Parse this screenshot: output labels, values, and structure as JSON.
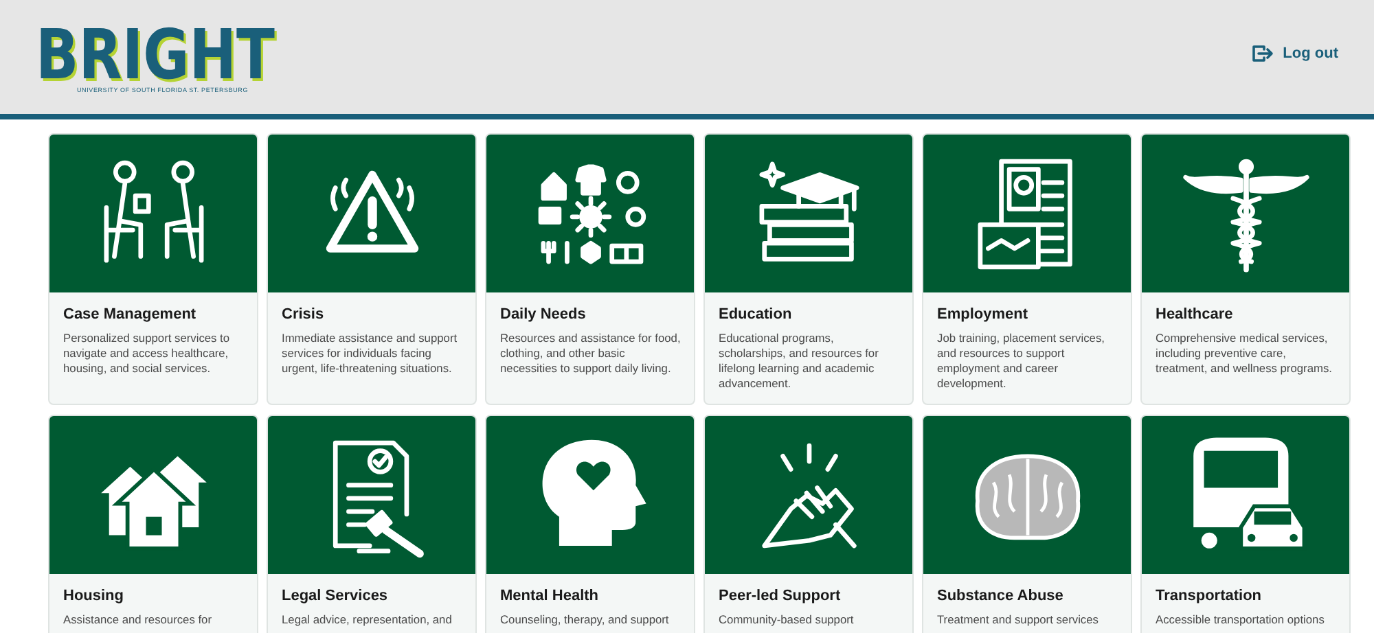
{
  "header": {
    "logo": "BRIGHT",
    "logo_subtitle": "UNIVERSITY OF SOUTH FLORIDA ST. PETERSBURG",
    "logout": "Log out"
  },
  "cards": [
    {
      "title": "Case Management",
      "description": "Personalized support services to navigate and access healthcare, housing, and social services."
    },
    {
      "title": "Crisis",
      "description": "Immediate assistance and support services for individuals facing urgent, life-threatening situations."
    },
    {
      "title": "Daily Needs",
      "description": "Resources and assistance for food, clothing, and other basic necessities to support daily living."
    },
    {
      "title": "Education",
      "description": "Educational programs, scholarships, and resources for lifelong learning and academic advancement."
    },
    {
      "title": "Employment",
      "description": "Job training, placement services, and resources to support employment and career development."
    },
    {
      "title": "Healthcare",
      "description": "Comprehensive medical services, including preventive care, treatment, and wellness programs."
    },
    {
      "title": "Housing",
      "description": "Assistance and resources for"
    },
    {
      "title": "Legal Services",
      "description": "Legal advice, representation, and"
    },
    {
      "title": "Mental Health",
      "description": "Counseling, therapy, and support"
    },
    {
      "title": "Peer-led Support",
      "description": "Community-based support"
    },
    {
      "title": "Substance Abuse",
      "description": "Treatment and support services"
    },
    {
      "title": "Transportation",
      "description": "Accessible transportation options"
    }
  ]
}
